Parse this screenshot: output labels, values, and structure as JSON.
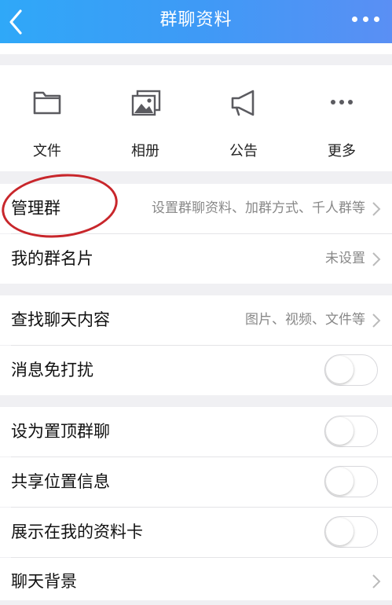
{
  "header": {
    "title": "群聊资料"
  },
  "tools": [
    {
      "label": "文件",
      "icon": "folder-icon"
    },
    {
      "label": "相册",
      "icon": "photos-icon"
    },
    {
      "label": "公告",
      "icon": "megaphone-icon"
    },
    {
      "label": "更多",
      "icon": "more-icon"
    }
  ],
  "settings": {
    "manage": {
      "label": "管理群",
      "value": "设置群聊资料、加群方式、千人群等"
    },
    "card_name": {
      "label": "我的群名片",
      "value": "未设置"
    },
    "search": {
      "label": "查找聊天内容",
      "value": "图片、视频、文件等"
    },
    "dnd": {
      "label": "消息免打扰",
      "on": false
    },
    "pin": {
      "label": "设为置顶群聊",
      "on": false
    },
    "location": {
      "label": "共享位置信息",
      "on": false
    },
    "show_card": {
      "label": "展示在我的资料卡",
      "on": false
    },
    "background": {
      "label": "聊天背景"
    }
  },
  "colors": {
    "header_gradient_start": "#2fa8f8",
    "header_gradient_end": "#5a8ff4",
    "annotation": "#c8262b"
  }
}
